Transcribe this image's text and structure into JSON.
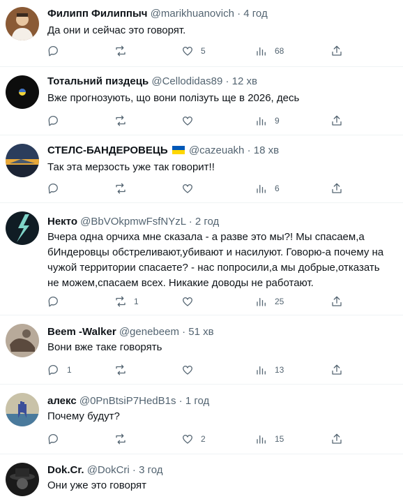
{
  "tweets": [
    {
      "name": "Филипп Филиппыч",
      "handle": "@marikhuanovich",
      "dot": "·",
      "time": "4 год",
      "text": "Да они и сейчас это говорят.",
      "replies": "",
      "retweets": "",
      "likes": "5",
      "views": "68",
      "avatar_icon": "avatar-person-icon"
    },
    {
      "name": "Тотальний пиздець",
      "handle": "@Cellodidas89",
      "dot": "·",
      "time": "12 хв",
      "text": "Вже прогнозують, що вони полізуть ще в 2026, десь",
      "replies": "",
      "retweets": "",
      "likes": "",
      "views": "9",
      "avatar_icon": "avatar-dark-circle-icon"
    },
    {
      "name": "СТЕЛС-БАНДЕРОВЕЦЬ",
      "handle": "@cazeuakh",
      "dot": "·",
      "time": "18 хв",
      "text": "Так эта мерзость уже так говорит!!",
      "replies": "",
      "retweets": "",
      "likes": "",
      "views": "6",
      "avatar_icon": "avatar-sunset-icon",
      "flag_colors": [
        "#0057b7",
        "#ffd700"
      ]
    },
    {
      "name": "Некто",
      "handle": "@BbVOkpmwFsfNYzL",
      "dot": "·",
      "time": "2 год",
      "text": "Вчера одна орчиха мне сказала - а разве это мы?! Мы спасаем,а бИндеровцы обстреливают,убивают и насилуют. Говорю-а почему на чужой территории спасаете? - нас попросили,а мы добрые,отказать не можем,спасаем всех. Никакие доводы не работают.",
      "replies": "",
      "retweets": "1",
      "likes": "",
      "views": "25",
      "avatar_icon": "avatar-lightning-icon"
    },
    {
      "name": "Beem -Walker",
      "handle": "@genebeem",
      "dot": "·",
      "time": "51 хв",
      "text": "Вони вже таке говорять",
      "replies": "1",
      "retweets": "",
      "likes": "",
      "views": "13",
      "avatar_icon": "avatar-photo-icon"
    },
    {
      "name": "алекс",
      "handle": "@0PnBtsiP7HedB1s",
      "dot": "·",
      "time": "1 год",
      "text": "Почему будут?",
      "replies": "",
      "retweets": "",
      "likes": "2",
      "views": "15",
      "avatar_icon": "avatar-hand-icon"
    },
    {
      "name": "Dok.Cr.",
      "handle": "@DokCri",
      "dot": "·",
      "time": "3 год",
      "text": "Они уже это говорят",
      "avatar_icon": "avatar-hat-icon"
    }
  ]
}
